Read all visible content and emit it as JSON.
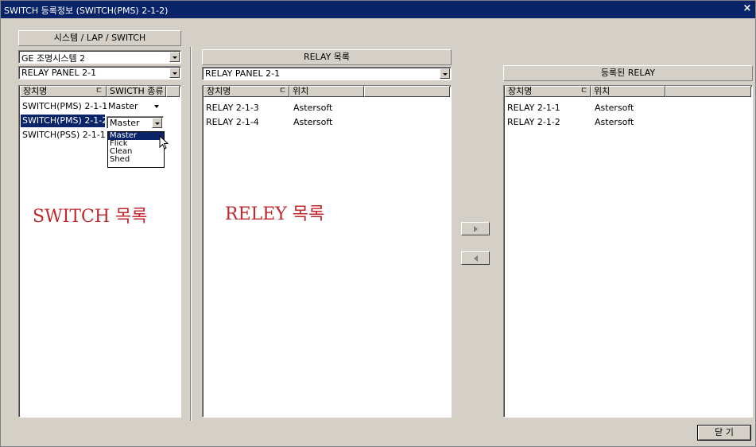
{
  "window": {
    "title": "SWITCH 등록정보 (SWITCH(PMS) 2-1-2)",
    "close_glyph": "×"
  },
  "left": {
    "caption": "시스템 / LAP / SWITCH",
    "system_select": "GE 조명시스템 2",
    "panel_select": "RELAY PANEL 2-1",
    "columns": [
      "장치명",
      "SWICTH 종류"
    ],
    "rows": [
      {
        "name": "SWITCH(PMS) 2-1-1",
        "type": "Master"
      },
      {
        "name": "SWITCH(PMS) 2-1-2",
        "type": "Master"
      },
      {
        "name": "SWITCH(PSS) 2-1-1",
        "type": ""
      }
    ],
    "dropdown_options": [
      "Master",
      "Flick",
      "Clean",
      "Shed"
    ],
    "annotation": "SWITCH 목록"
  },
  "middle": {
    "caption": "RELAY 목록",
    "panel_select": "RELAY PANEL 2-1",
    "columns": [
      "장치명",
      "위치"
    ],
    "rows": [
      {
        "name": "RELAY 2-1-3",
        "location": "Astersoft"
      },
      {
        "name": "RELAY 2-1-4",
        "location": "Astersoft"
      }
    ],
    "annotation": "RELEY 목록"
  },
  "transfer": {
    "add_icon": "arrow-right-icon",
    "remove_icon": "arrow-left-icon"
  },
  "right": {
    "caption": "등록된 RELAY",
    "columns": [
      "장치명",
      "위치"
    ],
    "rows": [
      {
        "name": "RELAY 2-1-1",
        "location": "Astersoft"
      },
      {
        "name": "RELAY 2-1-2",
        "location": "Astersoft"
      }
    ]
  },
  "footer": {
    "close_label": "닫 기"
  },
  "colors": {
    "titlebar": "#0a246a",
    "face": "#d4d0c8",
    "selection": "#0a246a",
    "annotation": "#c0282d"
  }
}
